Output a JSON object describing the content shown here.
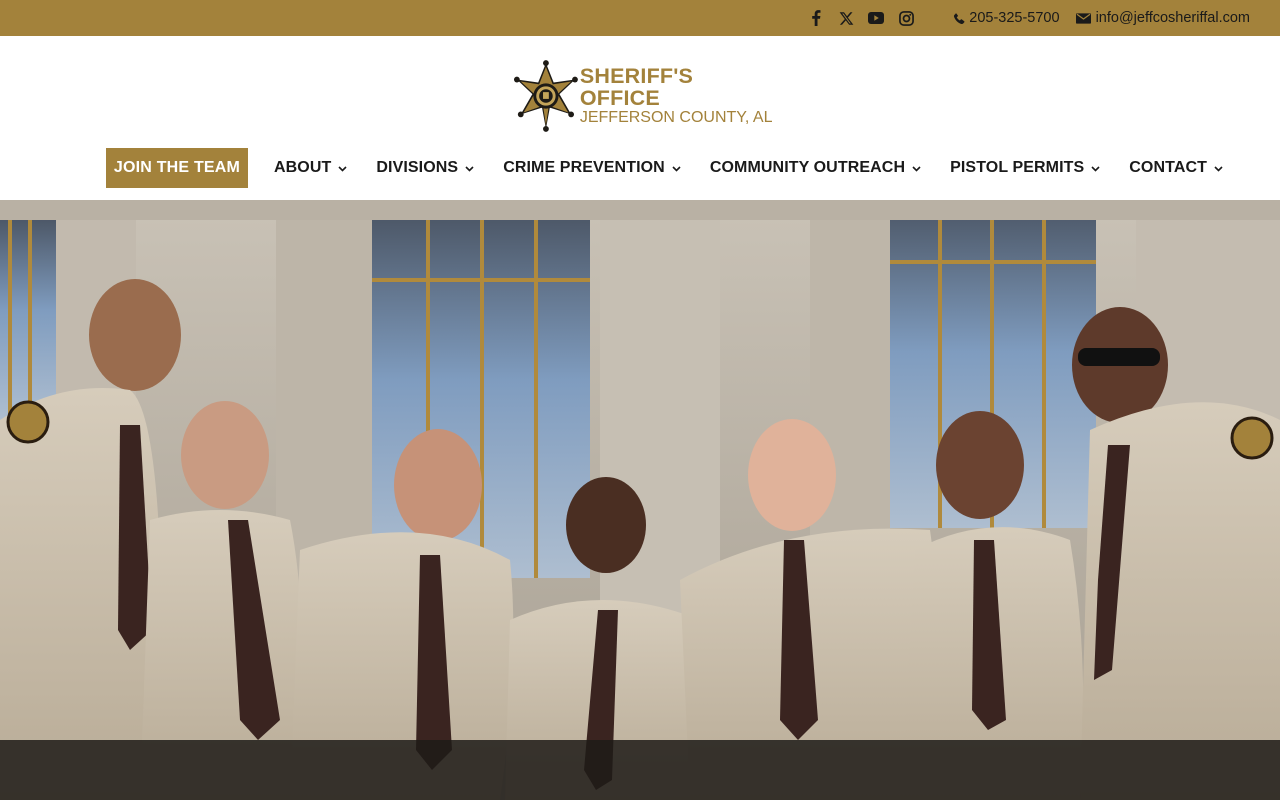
{
  "topbar": {
    "social": [
      {
        "icon": "facebook-icon"
      },
      {
        "icon": "x-twitter-icon"
      },
      {
        "icon": "youtube-icon"
      },
      {
        "icon": "instagram-icon"
      }
    ],
    "phone": "205-325-5700",
    "email": "info@jeffcosheriffal.com"
  },
  "logo": {
    "title": "SHERIFF'S OFFICE",
    "subtitle": "JEFFERSON COUNTY, AL"
  },
  "nav": {
    "join": "JOIN THE TEAM",
    "items": [
      {
        "label": "ABOUT"
      },
      {
        "label": "DIVISIONS"
      },
      {
        "label": "CRIME PREVENTION"
      },
      {
        "label": "COMMUNITY OUTREACH"
      },
      {
        "label": "PISTOL PERMITS"
      },
      {
        "label": "CONTACT"
      }
    ]
  },
  "colors": {
    "brand_gold": "#a3823b",
    "text_dark": "#1a1a1a",
    "header_bg": "#ffffff"
  }
}
